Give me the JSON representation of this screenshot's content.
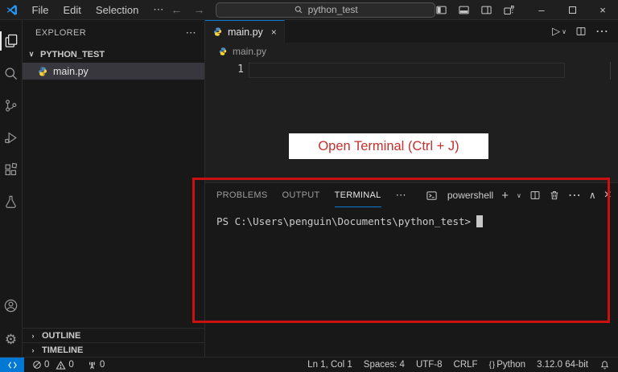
{
  "colors": {
    "accent": "#0078d4",
    "remote_blue": "#0078d4",
    "annotation_red": "#c5302c",
    "selection_bg": "#37373d"
  },
  "titlebar": {
    "menus": [
      "File",
      "Edit",
      "Selection"
    ],
    "more": "⋯",
    "back": "←",
    "forward": "→",
    "search": {
      "value": "python_test"
    },
    "window": {
      "minimize": "–",
      "close": "×"
    }
  },
  "sidebar": {
    "title": "EXPLORER",
    "more": "⋯",
    "section_chevron": "∨",
    "section": "PYTHON_TEST",
    "file": "main.py",
    "collapsed_chevron": "›",
    "outline": "OUTLINE",
    "timeline": "TIMELINE"
  },
  "editor": {
    "tab_label": "main.py",
    "tab_close": "×",
    "run": "▷",
    "run_dropdown": "∨",
    "split_more": "⋯",
    "breadcrumb": "main.py",
    "line_number": "1"
  },
  "annotation": {
    "label": "Open Terminal (Ctrl + J)"
  },
  "panel": {
    "tabs": [
      "PROBLEMS",
      "OUTPUT",
      "TERMINAL"
    ],
    "active_tab": "TERMINAL",
    "more": "⋯",
    "shell": "powershell",
    "new": "+",
    "dropdown": "∨",
    "collapse": "∧",
    "close": "×",
    "prompt": "PS C:\\Users\\penguin\\Documents\\python_test>"
  },
  "statusbar": {
    "errors": "0",
    "warnings": "0",
    "ports": "0",
    "cursor": "Ln 1, Col 1",
    "indent": "Spaces: 4",
    "encoding": "UTF-8",
    "eol": "CRLF",
    "language_icon": "{ }",
    "language": "Python",
    "interpreter": "3.12.0 64-bit"
  }
}
